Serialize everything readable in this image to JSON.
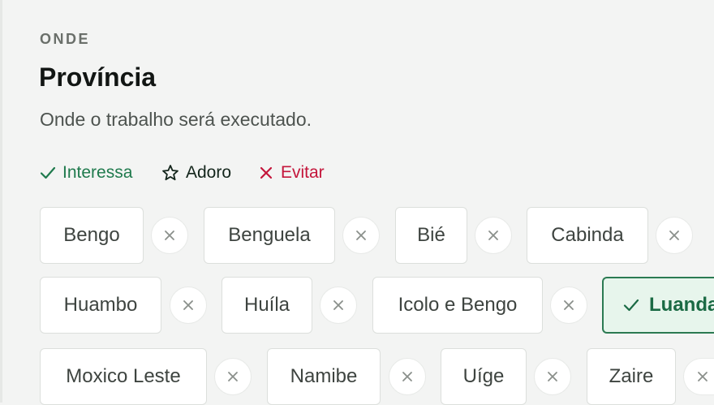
{
  "section": {
    "eyebrow": "ONDE",
    "title": "Província",
    "description": "Onde o trabalho será executado."
  },
  "legend": {
    "interest": "Interessa",
    "love": "Adoro",
    "avoid": "Evitar"
  },
  "colors": {
    "interest": "#1f7a4d",
    "avoid": "#c4163b",
    "selected_bg": "#e7f5ec",
    "selected_border": "#2b7a52"
  },
  "provinces": [
    {
      "label": "Bengo",
      "state": "none"
    },
    {
      "label": "Benguela",
      "state": "none"
    },
    {
      "label": "Bié",
      "state": "none"
    },
    {
      "label": "Cabinda",
      "state": "none"
    },
    {
      "label": "Huambo",
      "state": "none"
    },
    {
      "label": "Huíla",
      "state": "none"
    },
    {
      "label": "Icolo e Bengo",
      "state": "none"
    },
    {
      "label": "Luanda",
      "state": "interest"
    },
    {
      "label": "Moxico Leste",
      "state": "none"
    },
    {
      "label": "Namibe",
      "state": "none"
    },
    {
      "label": "Uíge",
      "state": "none"
    },
    {
      "label": "Zaire",
      "state": "none"
    }
  ]
}
